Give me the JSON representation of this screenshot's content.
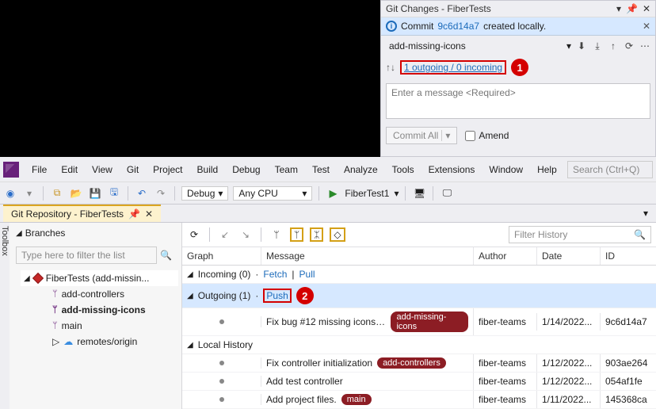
{
  "gitPanel": {
    "title": "Git Changes - FiberTests",
    "notif_prefix": "Commit",
    "notif_hash": "9c6d14a7",
    "notif_suffix": "created locally.",
    "branch": "add-missing-icons",
    "outgoing_link": "1 outgoing / 0 incoming",
    "callout1": "1",
    "msg_placeholder": "Enter a message <Required>",
    "commit_btn": "Commit All",
    "amend_label": "Amend"
  },
  "menu": [
    "File",
    "Edit",
    "View",
    "Git",
    "Project",
    "Build",
    "Debug",
    "Team",
    "Test",
    "Analyze",
    "Tools",
    "Extensions",
    "Window",
    "Help"
  ],
  "search_placeholder": "Search (Ctrl+Q)",
  "toolbar": {
    "config": "Debug",
    "platform": "Any CPU",
    "start_target": "FiberTest1"
  },
  "sideTab": "Toolbox",
  "docTab": "Git Repository - FiberTests",
  "branches": {
    "heading": "Branches",
    "filter_placeholder": "Type here to filter the list",
    "repo": "FiberTests (add-missin...",
    "items": [
      "add-controllers",
      "add-missing-icons",
      "main",
      "remotes/origin"
    ]
  },
  "history": {
    "columns": [
      "Graph",
      "Message",
      "Author",
      "Date",
      "ID"
    ],
    "filter_placeholder": "Filter History",
    "incoming_label": "Incoming (0)",
    "fetch": "Fetch",
    "pull": "Pull",
    "outgoing_label": "Outgoing (1)",
    "push": "Push",
    "callout2": "2",
    "localhistory_label": "Local History",
    "rows": [
      {
        "msg": "Fix bug #12 missing icons in...",
        "badge": "add-missing-icons",
        "author": "fiber-teams",
        "date": "1/14/2022...",
        "id": "9c6d14a7"
      },
      {
        "msg": "Fix controller initialization",
        "badge": "add-controllers",
        "author": "fiber-teams",
        "date": "1/12/2022...",
        "id": "903ae264"
      },
      {
        "msg": "Add test controller",
        "badge": "",
        "author": "fiber-teams",
        "date": "1/12/2022...",
        "id": "054af1fe"
      },
      {
        "msg": "Add project files.",
        "badge": "main",
        "author": "fiber-teams",
        "date": "1/11/2022...",
        "id": "145368ca"
      }
    ]
  }
}
